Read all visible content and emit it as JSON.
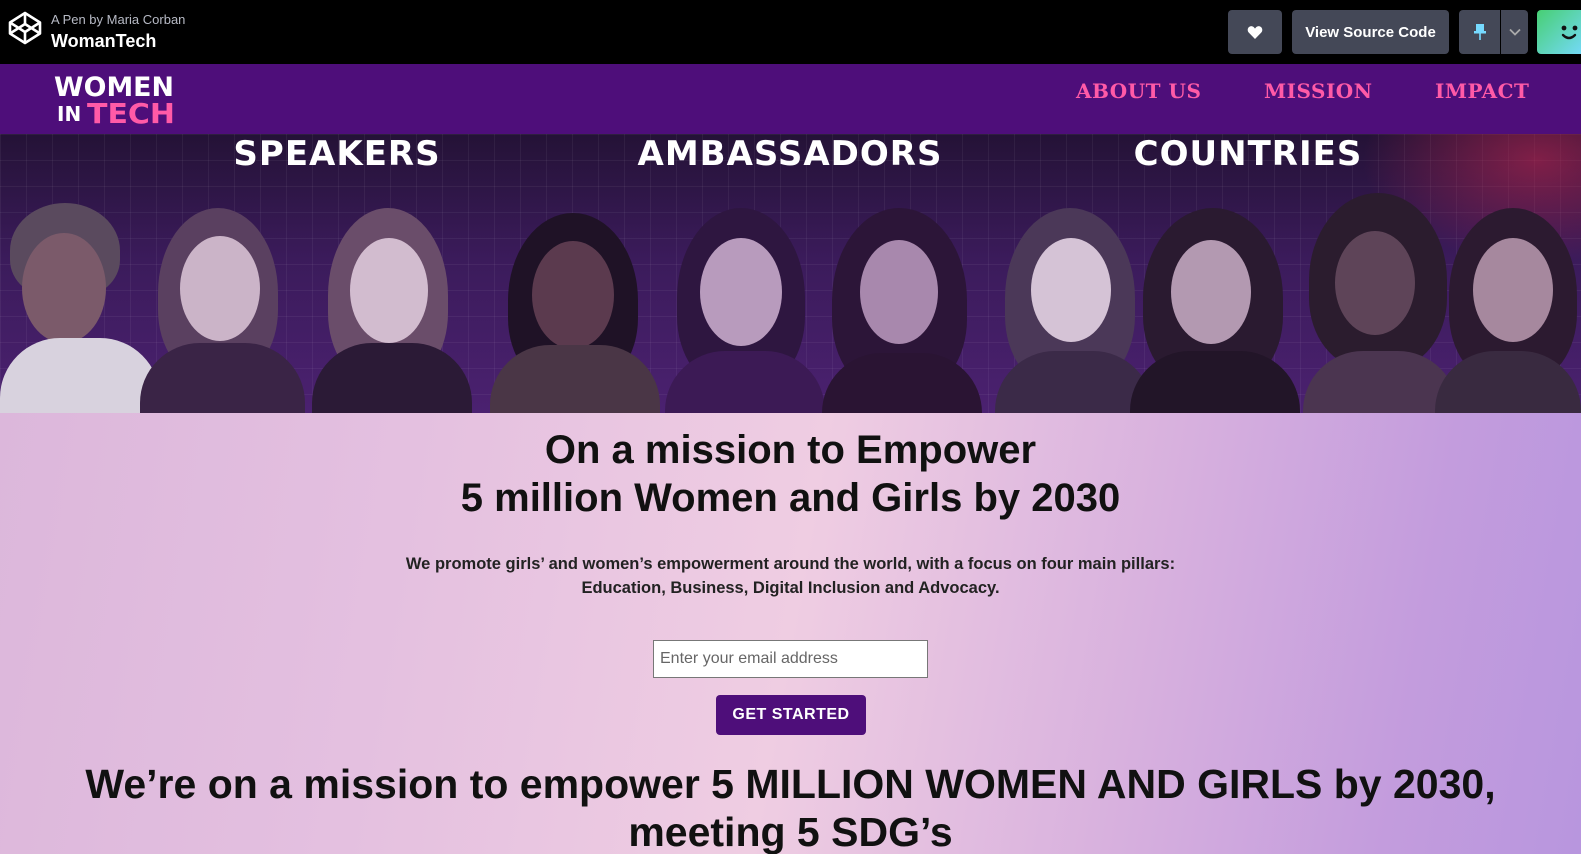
{
  "codepen": {
    "byline": "A Pen by Maria Corban",
    "pen_title": "WomanTech",
    "view_source_label": "View Source Code",
    "icons": [
      "codepen-logo-icon",
      "heart-icon",
      "pin-icon",
      "chevron-down-icon"
    ]
  },
  "site": {
    "logo_line1": "WOMEN",
    "logo_line2_in": "IN",
    "logo_line2_tech": "TECH",
    "nav": [
      {
        "label": "ABOUT US"
      },
      {
        "label": "MISSION"
      },
      {
        "label": "IMPACT"
      }
    ],
    "brand_color": "#4e0e7a",
    "nav_link_color": "#ff5aa7"
  },
  "hero": {
    "stats": [
      "SPEAKERS",
      "AMBASSADORS",
      "COUNTRIES"
    ]
  },
  "main": {
    "headline_line1": "On a mission to Empower",
    "headline_line2": "5 million Women and Girls by 2030",
    "blurb_line1": "We promote girls’ and women’s empowerment around the world, with a focus on four main pillars:",
    "blurb_line2": "Education, Business, Digital Inclusion and Advocacy.",
    "email_placeholder": "Enter your email address",
    "cta_label": "GET STARTED",
    "mission_line1": "We’re on a mission to empower 5 MILLION WOMEN AND GIRLS by 2030,",
    "mission_line2": "meeting 5 SDG’s"
  }
}
